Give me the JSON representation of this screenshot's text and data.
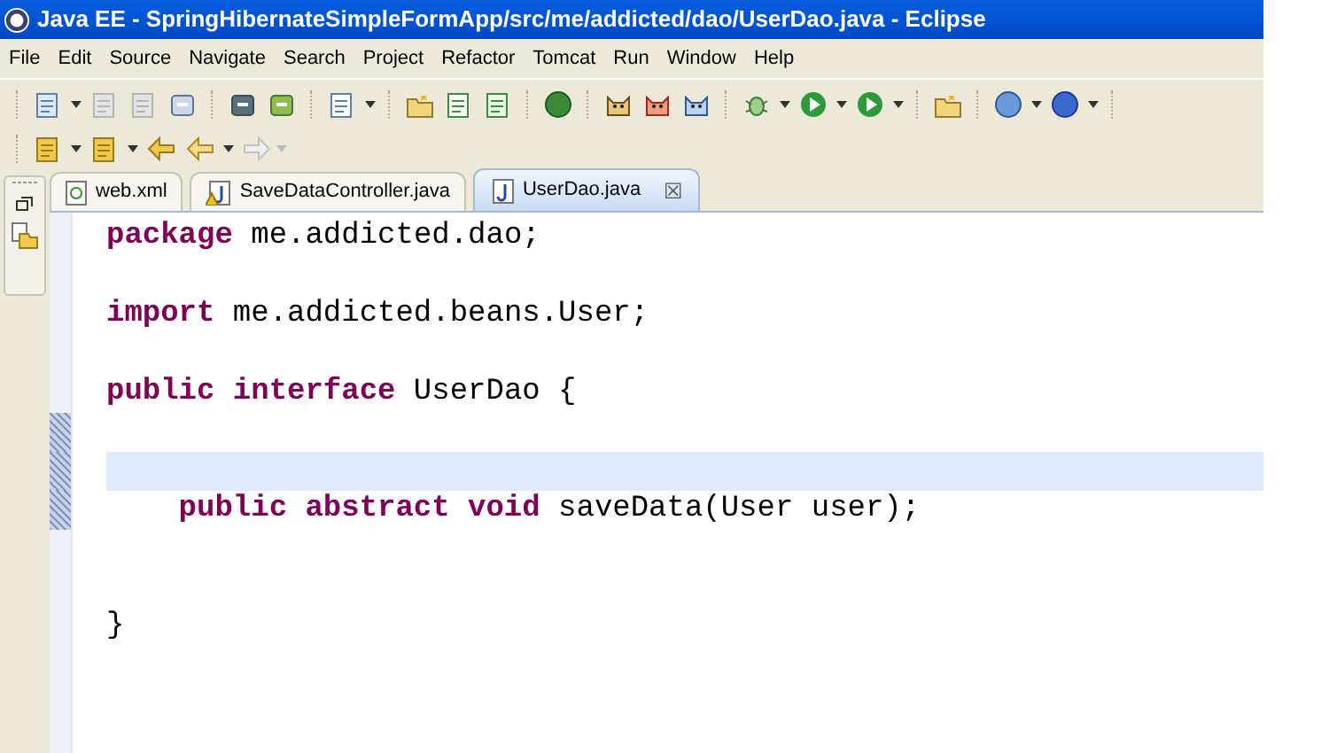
{
  "window": {
    "title": "Java EE - SpringHibernateSimpleFormApp/src/me/addicted/dao/UserDao.java - Eclipse"
  },
  "menu": [
    "File",
    "Edit",
    "Source",
    "Navigate",
    "Search",
    "Project",
    "Refactor",
    "Tomcat",
    "Run",
    "Window",
    "Help"
  ],
  "tabs": [
    {
      "label": "web.xml",
      "kind": "xml",
      "selected": false
    },
    {
      "label": "SaveDataController.java",
      "kind": "java-warning",
      "selected": false
    },
    {
      "label": "UserDao.java",
      "kind": "java",
      "selected": true,
      "close": "☒"
    }
  ],
  "code": {
    "lines": [
      {
        "current": false,
        "tokens": [
          {
            "text": "package",
            "kind": "keyword"
          },
          {
            "text": " me.addicted.dao;",
            "kind": "plain"
          }
        ]
      },
      {
        "current": false
      },
      {
        "current": false,
        "tokens": [
          {
            "text": "import",
            "kind": "keyword"
          },
          {
            "text": " me.addicted.beans.User;",
            "kind": "plain"
          }
        ]
      },
      {
        "current": false
      },
      {
        "current": false,
        "tokens": [
          {
            "text": "public interface",
            "kind": "keyword"
          },
          {
            "text": " UserDao {",
            "kind": "plain"
          }
        ]
      },
      {
        "current": false
      },
      {
        "current": true
      },
      {
        "current": false,
        "tokens": [
          {
            "text": "    public abstract void",
            "kind": "keyword"
          },
          {
            "text": " saveData(User user);",
            "kind": "plain"
          }
        ]
      },
      {
        "current": false
      },
      {
        "current": false
      },
      {
        "current": false,
        "tokens": [
          {
            "text": "}",
            "kind": "plain"
          }
        ]
      }
    ]
  }
}
